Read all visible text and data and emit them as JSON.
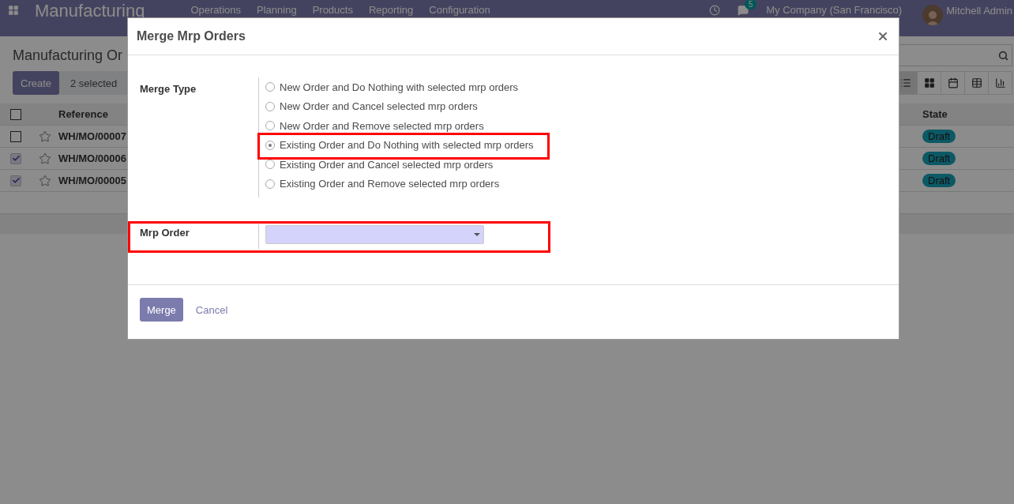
{
  "navbar": {
    "app_title": "Manufacturing",
    "menu": [
      "Operations",
      "Planning",
      "Products",
      "Reporting",
      "Configuration"
    ],
    "messages_count": "5",
    "company": "My Company (San Francisco)",
    "user": "Mitchell Admin"
  },
  "breadcrumb": "Manufacturing Or",
  "actions": {
    "create": "Create",
    "selection": "2 selected"
  },
  "views": [
    {
      "kind": "list",
      "selected": true
    },
    {
      "kind": "kanban",
      "selected": false
    },
    {
      "kind": "calendar",
      "selected": false
    },
    {
      "kind": "pivot",
      "selected": false
    },
    {
      "kind": "graph",
      "selected": false
    }
  ],
  "table": {
    "header_checked": false,
    "columns": [
      "Reference",
      "State"
    ],
    "rows": [
      {
        "checked": false,
        "reference": "WH/MO/00007",
        "state": "Draft"
      },
      {
        "checked": true,
        "reference": "WH/MO/00006",
        "state": "Draft"
      },
      {
        "checked": true,
        "reference": "WH/MO/00005",
        "state": "Draft"
      }
    ]
  },
  "dialog": {
    "title": "Merge Mrp Orders",
    "merge_type": {
      "label": "Merge Type",
      "options": [
        {
          "label": "New Order and Do Nothing with selected mrp orders",
          "selected": false,
          "highlighted": false
        },
        {
          "label": "New Order and Cancel selected mrp orders",
          "selected": false,
          "highlighted": false
        },
        {
          "label": "New Order and Remove selected mrp orders",
          "selected": false,
          "highlighted": false
        },
        {
          "label": "Existing Order and Do Nothing with selected mrp orders",
          "selected": true,
          "highlighted": true
        },
        {
          "label": "Existing Order and Cancel selected mrp orders",
          "selected": false,
          "highlighted": false
        },
        {
          "label": "Existing Order and Remove selected mrp orders",
          "selected": false,
          "highlighted": false
        }
      ]
    },
    "mrp_order": {
      "label": "Mrp Order",
      "highlighted": true
    },
    "buttons": {
      "merge": "Merge",
      "cancel": "Cancel"
    }
  }
}
